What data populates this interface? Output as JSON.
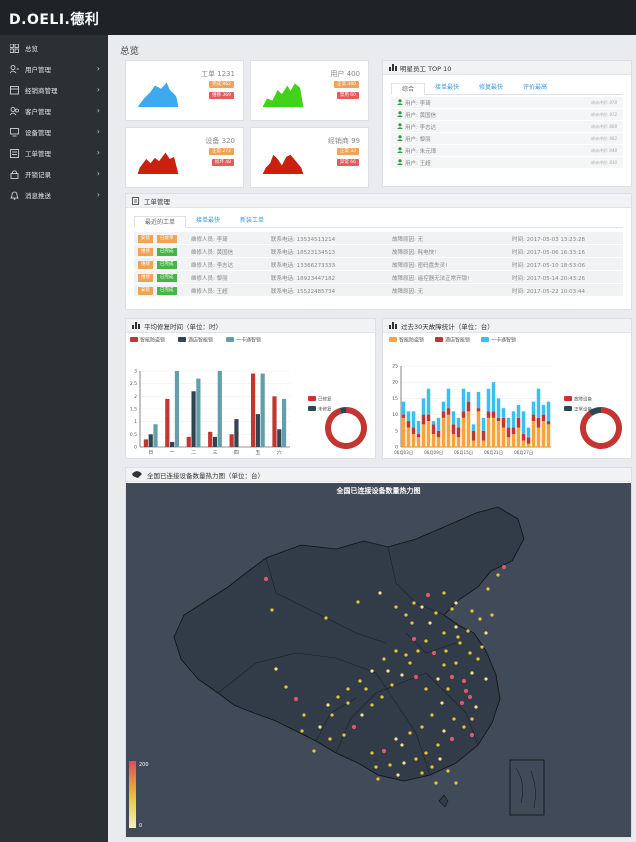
{
  "app": {
    "logo": "D.OELI.德利"
  },
  "sidebar": {
    "items": [
      {
        "label": "总览",
        "icon": "grid-icon",
        "arrow": false
      },
      {
        "label": "用户管理",
        "icon": "user-icon",
        "arrow": true
      },
      {
        "label": "经销商管理",
        "icon": "store-icon",
        "arrow": true
      },
      {
        "label": "客户管理",
        "icon": "users-icon",
        "arrow": true
      },
      {
        "label": "设备管理",
        "icon": "monitor-icon",
        "arrow": true
      },
      {
        "label": "工单管理",
        "icon": "ticket-icon",
        "arrow": true
      },
      {
        "label": "开锁记录",
        "icon": "lock-icon",
        "arrow": true
      },
      {
        "label": "消息推送",
        "icon": "bell-icon",
        "arrow": true
      }
    ]
  },
  "page": {
    "title": "总览"
  },
  "stats": [
    {
      "label": "工单 1231",
      "chips": [
        "完成 862",
        "维修 369"
      ],
      "color": "#3fa9ef"
    },
    {
      "label": "用户 400",
      "chips": [
        "正常 340",
        "禁用 60"
      ],
      "color": "#41d21a"
    },
    {
      "label": "设备 320",
      "chips": [
        "正常 272",
        "损坏 48"
      ],
      "color": "#c9200f"
    },
    {
      "label": "经销商 99",
      "chips": [
        "正常 33",
        "异常 66"
      ],
      "color": "#c9200f"
    }
  ],
  "star_staff": {
    "title": "明星员工  TOP 10",
    "tabs": [
      "综合",
      "接单最快",
      "修复最快",
      "评价最高"
    ],
    "rows": [
      {
        "name": "用户: 李琦",
        "score": "综合评价: 878"
      },
      {
        "name": "用户: 黄国信",
        "score": "综合评价: 872"
      },
      {
        "name": "用户: 李志达",
        "score": "综合评价: 868"
      },
      {
        "name": "用户: 黎丽",
        "score": "综合评价: 862"
      },
      {
        "name": "用户: 朱元璋",
        "score": "综合评价: 848"
      },
      {
        "name": "用户: 王超",
        "score": "综合评价: 830"
      }
    ]
  },
  "orders": {
    "title": "工单管理",
    "tabs": [
      "最近的工单",
      "接单最快",
      "新装工单"
    ],
    "rows": [
      {
        "type": "安装",
        "status": "已接单",
        "worker": "维修人员: 李琦",
        "phone": "联系电话: 13534513214",
        "reason": "故障原因: 无",
        "time": "时间: 2017-05-03 13:23:28"
      },
      {
        "type": "维修",
        "status": "已完成",
        "worker": "维修人员: 黄国信",
        "phone": "联系电话: 18523134513",
        "reason": "故障原因: 耗电快!",
        "time": "时间: 2017-05-06 16:33:16"
      },
      {
        "type": "维修",
        "status": "已完成",
        "worker": "维修人员: 李志达",
        "phone": "联系电话: 13366273333",
        "reason": "故障原因: 密码盘失灵!",
        "time": "时间: 2017-05-10 18:53:06"
      },
      {
        "type": "维修",
        "status": "已完成",
        "worker": "维修人员: 黎丽",
        "phone": "联系电话: 18923447182",
        "reason": "故障原因: 遥控器无法正常开锁!",
        "time": "时间: 2017-05-14 20:43:26"
      },
      {
        "type": "安装",
        "status": "已完成",
        "worker": "维修人员: 王超",
        "phone": "联系电话: 15522485734",
        "reason": "故障原因: 无",
        "time": "时间: 2017-05-22 10:03:44"
      }
    ]
  },
  "repair_panel": {
    "title": "平均修复时间（单位：时）"
  },
  "fault_panel": {
    "title": "过去30天故障统计（单位：台）"
  },
  "map_panel": {
    "title": "全国已连接设备数量热力图（单位：台）",
    "map_title": "全国已连接设备数量热力图",
    "scale_max": "200",
    "scale_min": "0"
  },
  "chart_data": [
    {
      "type": "bar",
      "categories": [
        "日",
        "一",
        "二",
        "三",
        "四",
        "五",
        "六"
      ],
      "series": [
        {
          "name": "智能防盗锁",
          "values": [
            0.3,
            1.9,
            0.4,
            0.6,
            0.5,
            2.9,
            2.0
          ],
          "color": "#c23531"
        },
        {
          "name": "酒店智能锁",
          "values": [
            0.5,
            0.2,
            2.2,
            0.4,
            1.1,
            1.3,
            0.7
          ],
          "color": "#2f4554"
        },
        {
          "name": "一卡通智锁",
          "values": [
            0.9,
            3.0,
            2.7,
            3.0,
            0.0,
            2.9,
            1.9
          ],
          "color": "#61a0a8"
        }
      ],
      "ylim": [
        0,
        3
      ],
      "yticks": [
        "0",
        "0.5",
        "1",
        "1.5",
        "2",
        "2.5",
        "3"
      ]
    },
    {
      "type": "pie",
      "labels": [
        "已修复",
        "未修复"
      ],
      "values": [
        95,
        5
      ],
      "colors": [
        "#c23531",
        "#2f4554"
      ]
    },
    {
      "type": "bar",
      "stacked": true,
      "x_ticks": [
        "06月03日",
        "06月09日",
        "06月15日",
        "06月21日",
        "06月27日"
      ],
      "series": [
        {
          "name": "智能防盗锁",
          "color": "#f8a43a",
          "values": [
            9,
            6,
            4,
            3,
            7,
            8,
            4,
            3,
            9,
            10,
            4,
            3,
            9,
            11,
            2,
            11,
            2,
            9,
            9,
            8,
            6,
            3,
            4,
            6,
            2,
            1,
            8,
            6,
            8,
            7
          ]
        },
        {
          "name": "酒店智能锁",
          "color": "#c23531",
          "values": [
            1,
            2,
            2,
            1,
            3,
            2,
            3,
            2,
            2,
            2,
            3,
            3,
            2,
            3,
            3,
            1,
            3,
            2,
            2,
            1,
            3,
            3,
            2,
            3,
            2,
            2,
            2,
            3,
            2,
            1
          ]
        },
        {
          "name": "一卡通智锁",
          "color": "#39c0f0",
          "values": [
            4,
            3,
            5,
            4,
            5,
            8,
            1,
            4,
            3,
            6,
            4,
            3,
            7,
            3,
            2,
            5,
            4,
            7,
            9,
            6,
            3,
            3,
            5,
            4,
            7,
            3,
            4,
            9,
            3,
            6
          ]
        }
      ],
      "ylim": [
        0,
        25
      ],
      "yticks": [
        "0",
        "5",
        "10",
        "15",
        "20",
        "25"
      ]
    },
    {
      "type": "pie",
      "labels": [
        "故障设备",
        "正常设备"
      ],
      "values": [
        90,
        10
      ],
      "colors": [
        "#c23531",
        "#2f4554"
      ]
    }
  ]
}
